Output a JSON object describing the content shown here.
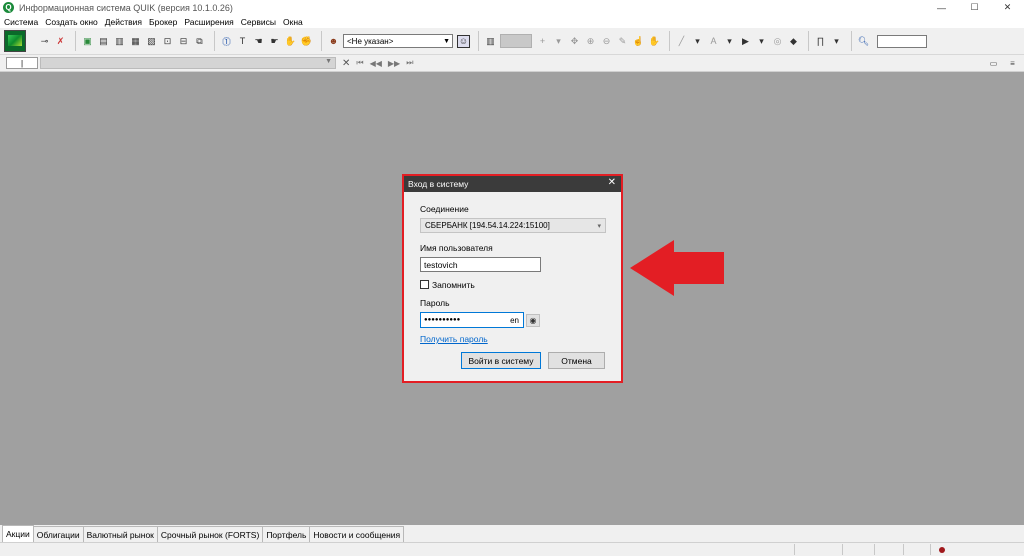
{
  "window": {
    "title": "Информационная система QUIK (версия 10.1.0.26)",
    "app_icon": "Q",
    "min": "—",
    "max": "☐",
    "close": "✕"
  },
  "menu": [
    "Система",
    "Создать окно",
    "Действия",
    "Брокер",
    "Расширения",
    "Сервисы",
    "Окна"
  ],
  "toolbar": {
    "account_select": "<Не указан>"
  },
  "toolbar2": {
    "box_text": "|"
  },
  "dialog": {
    "title": "Вход в систему",
    "close": "✕",
    "connection_label": "Соединение",
    "connection_value": "СБЕРБАНК [194.54.14.224:15100]",
    "username_label": "Имя пользователя",
    "username_value": "testovich",
    "remember_label": "Запомнить",
    "password_label": "Пароль",
    "password_value": "●●●●●●●●●●",
    "password_lang": "en",
    "get_password_link": "Получить пароль",
    "login_button": "Войти в систему",
    "cancel_button": "Отмена"
  },
  "tabs": [
    "Акции",
    "Облигации",
    "Валютный рынок",
    "Срочный рынок (FORTS)",
    "Портфель",
    "Новости и сообщения"
  ],
  "active_tab": "Акции",
  "colors": {
    "highlight_frame": "#e31e24",
    "arrow": "#e31e24",
    "workspace": "#a0a0a0",
    "dialog_title_bg": "#3b3b3b",
    "link": "#0066cc",
    "status_indicator": "#a0181c"
  }
}
